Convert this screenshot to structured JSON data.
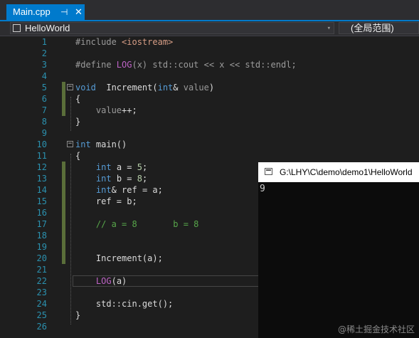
{
  "tab": {
    "filename": "Main.cpp",
    "pin": "⊣",
    "close": "✕"
  },
  "nav": {
    "project": "HelloWorld",
    "scope": "(全局范围)",
    "dropdown": "▾"
  },
  "editor": {
    "lines": [
      {
        "n": "1",
        "parts": [
          [
            "pp",
            "#include "
          ],
          [
            "str",
            "<iostream>"
          ]
        ]
      },
      {
        "n": "2",
        "parts": []
      },
      {
        "n": "3",
        "parts": [
          [
            "pp",
            "#define "
          ],
          [
            "mac",
            "LOG"
          ],
          [
            "pp",
            "(x) std::cout << x << std::endl;"
          ]
        ]
      },
      {
        "n": "4",
        "parts": []
      },
      {
        "n": "5",
        "parts": [
          [
            "kw",
            "void"
          ],
          [
            "",
            "  Increment("
          ],
          [
            "kw",
            "int"
          ],
          [
            "",
            "& "
          ],
          [
            "par",
            "value"
          ],
          [
            "",
            ")"
          ]
        ]
      },
      {
        "n": "6",
        "parts": [
          [
            "",
            "{"
          ]
        ]
      },
      {
        "n": "7",
        "parts": [
          [
            "",
            "    "
          ],
          [
            "par",
            "value"
          ],
          [
            "",
            "++;"
          ]
        ]
      },
      {
        "n": "8",
        "parts": [
          [
            "",
            "}"
          ]
        ]
      },
      {
        "n": "9",
        "parts": []
      },
      {
        "n": "10",
        "parts": [
          [
            "kw",
            "int"
          ],
          [
            "",
            " main()"
          ]
        ]
      },
      {
        "n": "11",
        "parts": [
          [
            "",
            "{"
          ]
        ]
      },
      {
        "n": "12",
        "parts": [
          [
            "",
            "    "
          ],
          [
            "kw",
            "int"
          ],
          [
            "",
            " a = "
          ],
          [
            "num",
            "5"
          ],
          [
            "",
            ";"
          ]
        ]
      },
      {
        "n": "13",
        "parts": [
          [
            "",
            "    "
          ],
          [
            "kw",
            "int"
          ],
          [
            "",
            " b = "
          ],
          [
            "num",
            "8"
          ],
          [
            "",
            ";"
          ]
        ]
      },
      {
        "n": "14",
        "parts": [
          [
            "",
            "    "
          ],
          [
            "kw",
            "int"
          ],
          [
            "",
            "& ref = a;"
          ]
        ]
      },
      {
        "n": "15",
        "parts": [
          [
            "",
            "    ref = b;"
          ]
        ]
      },
      {
        "n": "16",
        "parts": []
      },
      {
        "n": "17",
        "parts": [
          [
            "",
            "    "
          ],
          [
            "cm",
            "// a = 8       b = 8"
          ]
        ]
      },
      {
        "n": "18",
        "parts": []
      },
      {
        "n": "19",
        "parts": []
      },
      {
        "n": "20",
        "parts": [
          [
            "",
            "    Increment(a);"
          ]
        ]
      },
      {
        "n": "21",
        "parts": []
      },
      {
        "n": "22",
        "parts": [
          [
            "",
            "    "
          ],
          [
            "mac",
            "LOG"
          ],
          [
            "",
            "(a)"
          ]
        ]
      },
      {
        "n": "23",
        "parts": []
      },
      {
        "n": "24",
        "parts": [
          [
            "",
            "    std::cin.get();"
          ]
        ]
      },
      {
        "n": "25",
        "parts": [
          [
            "",
            "}"
          ]
        ]
      },
      {
        "n": "26",
        "parts": []
      }
    ]
  },
  "console": {
    "title": "G:\\LHY\\C\\demo\\demo1\\HelloWorld",
    "output": "9"
  },
  "watermark": "@稀土掘金技术社区"
}
